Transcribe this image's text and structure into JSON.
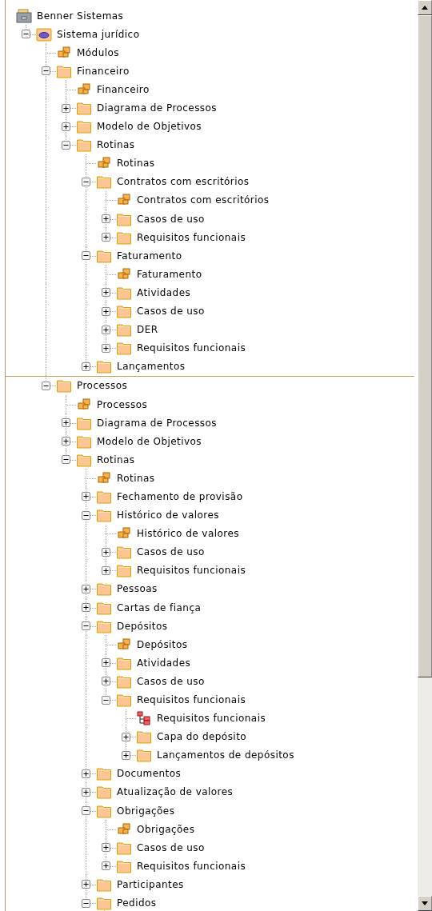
{
  "tree": [
    {
      "label": "Benner Sistemas",
      "kind": "root",
      "children": [
        {
          "label": "Sistema jurídico",
          "kind": "module",
          "expanded": true,
          "children": [
            {
              "label": "Módulos",
              "kind": "package"
            },
            {
              "label": "Financeiro",
              "kind": "folder",
              "expanded": true,
              "children": [
                {
                  "label": "Financeiro",
                  "kind": "package"
                },
                {
                  "label": "Diagrama de Processos",
                  "kind": "folder",
                  "expanded": false
                },
                {
                  "label": "Modelo de Objetivos",
                  "kind": "folder",
                  "expanded": false
                },
                {
                  "label": "Rotinas",
                  "kind": "folder",
                  "expanded": true,
                  "children": [
                    {
                      "label": "Rotinas",
                      "kind": "package"
                    },
                    {
                      "label": "Contratos com escritórios",
                      "kind": "folder",
                      "expanded": true,
                      "children": [
                        {
                          "label": "Contratos com escritórios",
                          "kind": "package"
                        },
                        {
                          "label": "Casos de uso",
                          "kind": "folder",
                          "expanded": false
                        },
                        {
                          "label": "Requisitos funcionais",
                          "kind": "folder",
                          "expanded": false
                        }
                      ]
                    },
                    {
                      "label": "Faturamento",
                      "kind": "folder",
                      "expanded": true,
                      "children": [
                        {
                          "label": "Faturamento",
                          "kind": "package"
                        },
                        {
                          "label": "Atividades",
                          "kind": "folder",
                          "expanded": false
                        },
                        {
                          "label": "Casos de uso",
                          "kind": "folder",
                          "expanded": false
                        },
                        {
                          "label": "DER",
                          "kind": "folder",
                          "expanded": false
                        },
                        {
                          "label": "Requisitos funcionais",
                          "kind": "folder",
                          "expanded": false
                        }
                      ]
                    },
                    {
                      "label": "Lançamentos",
                      "kind": "folder",
                      "expanded": false
                    }
                  ]
                }
              ]
            },
            {
              "label": "Processos",
              "kind": "folder",
              "expanded": true,
              "seam_before": true,
              "children": [
                {
                  "label": "Processos",
                  "kind": "package"
                },
                {
                  "label": "Diagrama de Processos",
                  "kind": "folder",
                  "expanded": false
                },
                {
                  "label": "Modelo de Objetivos",
                  "kind": "folder",
                  "expanded": false
                },
                {
                  "label": "Rotinas",
                  "kind": "folder",
                  "expanded": true,
                  "children": [
                    {
                      "label": "Rotinas",
                      "kind": "package"
                    },
                    {
                      "label": "Fechamento de provisão",
                      "kind": "folder",
                      "expanded": false
                    },
                    {
                      "label": "Histórico de valores",
                      "kind": "folder",
                      "expanded": true,
                      "children": [
                        {
                          "label": "Histórico de valores",
                          "kind": "package"
                        },
                        {
                          "label": "Casos de uso",
                          "kind": "folder",
                          "expanded": false
                        },
                        {
                          "label": "Requisitos funcionais",
                          "kind": "folder",
                          "expanded": false
                        }
                      ]
                    },
                    {
                      "label": "Pessoas",
                      "kind": "folder",
                      "expanded": false
                    },
                    {
                      "label": "Cartas de fiança",
                      "kind": "folder",
                      "expanded": false
                    },
                    {
                      "label": "Depósitos",
                      "kind": "folder",
                      "expanded": true,
                      "children": [
                        {
                          "label": "Depósitos",
                          "kind": "package"
                        },
                        {
                          "label": "Atividades",
                          "kind": "folder",
                          "expanded": false
                        },
                        {
                          "label": "Casos de uso",
                          "kind": "folder",
                          "expanded": false
                        },
                        {
                          "label": "Requisitos funcionais",
                          "kind": "folder",
                          "expanded": true,
                          "children": [
                            {
                              "label": "Requisitos funcionais",
                              "kind": "diagram"
                            },
                            {
                              "label": "Capa do depósito",
                              "kind": "folder",
                              "expanded": false
                            },
                            {
                              "label": "Lançamentos de depósitos",
                              "kind": "folder",
                              "expanded": false
                            }
                          ]
                        }
                      ]
                    },
                    {
                      "label": "Documentos",
                      "kind": "folder",
                      "expanded": false
                    },
                    {
                      "label": "Atualização de valores",
                      "kind": "folder",
                      "expanded": false
                    },
                    {
                      "label": "Obrigações",
                      "kind": "folder",
                      "expanded": true,
                      "children": [
                        {
                          "label": "Obrigações",
                          "kind": "package"
                        },
                        {
                          "label": "Casos de uso",
                          "kind": "folder",
                          "expanded": false
                        },
                        {
                          "label": "Requisitos funcionais",
                          "kind": "folder",
                          "expanded": false
                        }
                      ]
                    },
                    {
                      "label": "Participantes",
                      "kind": "folder",
                      "expanded": false
                    },
                    {
                      "label": "Pedidos",
                      "kind": "folder",
                      "expanded": true
                    }
                  ]
                }
              ]
            }
          ]
        }
      ]
    }
  ]
}
